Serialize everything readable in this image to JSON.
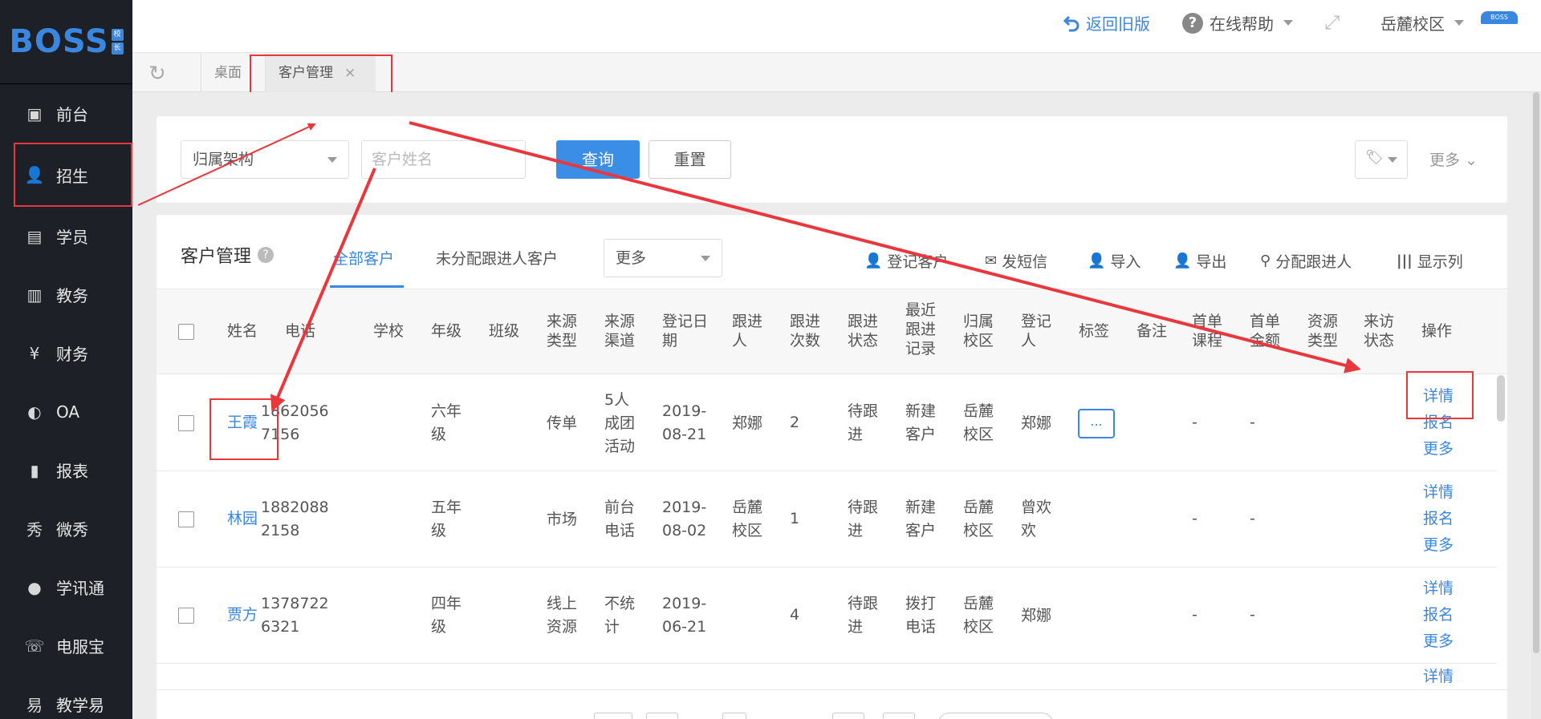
{
  "app": {
    "logo_main": "BOSS",
    "logo_badge": [
      "校",
      "长"
    ]
  },
  "sidebar": {
    "items": [
      {
        "label": "前台",
        "icon": "window-icon"
      },
      {
        "label": "招生",
        "icon": "user-add-icon"
      },
      {
        "label": "学员",
        "icon": "id-card-icon"
      },
      {
        "label": "教务",
        "icon": "book-icon"
      },
      {
        "label": "财务",
        "icon": "yen-icon"
      },
      {
        "label": "OA",
        "icon": "oa-icon"
      },
      {
        "label": "报表",
        "icon": "bar-chart-icon"
      },
      {
        "label": "微秀",
        "icon": "weixiu-icon"
      },
      {
        "label": "学讯通",
        "icon": "location-pin-icon"
      },
      {
        "label": "电服宝",
        "icon": "phone-icon"
      },
      {
        "label": "教学易",
        "icon": "teach-icon"
      }
    ]
  },
  "topbar": {
    "back_label": "返回旧版",
    "help_label": "在线帮助",
    "campus_label": "岳麓校区",
    "badge": "BOSS"
  },
  "tabs": {
    "items": [
      {
        "label": "桌面"
      },
      {
        "label": "客户管理",
        "close": "×"
      }
    ]
  },
  "filter": {
    "org_select": "归属架构",
    "name_placeholder": "客户姓名",
    "query_label": "查询",
    "reset_label": "重置",
    "more_label": "更多"
  },
  "main": {
    "title": "客户管理",
    "tab_all": "全部客户",
    "tab_unassigned": "未分配跟进人客户",
    "more_select": "更多",
    "actions": {
      "register": "登记客户",
      "sms": "发短信",
      "import": "导入",
      "export": "导出",
      "assign": "分配跟进人",
      "columns": "显示列"
    }
  },
  "table": {
    "headers": {
      "name": "姓名",
      "phone": "电话",
      "school": "学校",
      "grade": "年级",
      "class": "班级",
      "source_type": [
        "来源",
        "类型"
      ],
      "source_channel": [
        "来源",
        "渠道"
      ],
      "reg_date": [
        "登记日",
        "期"
      ],
      "follower": [
        "跟进",
        "人"
      ],
      "follow_count": [
        "跟进",
        "次数"
      ],
      "follow_status": [
        "跟进",
        "状态"
      ],
      "latest_record": [
        "最近",
        "跟进",
        "记录"
      ],
      "campus": [
        "归属",
        "校区"
      ],
      "registrar": [
        "登记",
        "人"
      ],
      "tags": "标签",
      "remark": "备注",
      "first_course": [
        "首单",
        "课程"
      ],
      "first_amount": [
        "首单",
        "金额"
      ],
      "resource_type": [
        "资源",
        "类型"
      ],
      "visit_status": [
        "来访",
        "状态"
      ],
      "ops": "操作"
    },
    "rows": [
      {
        "name": "王霞",
        "phone": [
          "1862056",
          "7156"
        ],
        "grade": [
          "六年",
          "级"
        ],
        "source_type": [
          "传单"
        ],
        "source_channel": [
          "5人",
          "成团",
          "活动"
        ],
        "reg_date": [
          "2019-",
          "08-21"
        ],
        "follower": [
          "郑娜"
        ],
        "follow_count": "2",
        "follow_status": [
          "待跟",
          "进"
        ],
        "latest_record": [
          "新建",
          "客户"
        ],
        "campus": [
          "岳麓",
          "校区"
        ],
        "registrar": [
          "郑娜"
        ],
        "tag_btn": "...",
        "first_course": "-",
        "first_amount": "-",
        "ops": [
          "详情",
          "报名",
          "更多"
        ]
      },
      {
        "name": "林园",
        "phone": [
          "1882088",
          "2158"
        ],
        "grade": [
          "五年",
          "级"
        ],
        "source_type": [
          "市场"
        ],
        "source_channel": [
          "前台",
          "电话"
        ],
        "reg_date": [
          "2019-",
          "08-02"
        ],
        "follower": [
          "岳麓",
          "校区"
        ],
        "follow_count": "1",
        "follow_status": [
          "待跟",
          "进"
        ],
        "latest_record": [
          "新建",
          "客户"
        ],
        "campus": [
          "岳麓",
          "校区"
        ],
        "registrar": [
          "曾欢",
          "欢"
        ],
        "first_course": "-",
        "first_amount": "-",
        "ops": [
          "详情",
          "报名",
          "更多"
        ]
      },
      {
        "name": "贾方",
        "phone": [
          "1378722",
          "6321"
        ],
        "grade": [
          "四年",
          "级"
        ],
        "source_type": [
          "线上",
          "资源"
        ],
        "source_channel": [
          "不统",
          "计"
        ],
        "reg_date": [
          "2019-",
          "06-21"
        ],
        "follower": [
          ""
        ],
        "follow_count": "4",
        "follow_status": [
          "待跟",
          "进"
        ],
        "latest_record": [
          "拨打",
          "电话"
        ],
        "campus": [
          "岳麓",
          "校区"
        ],
        "registrar": [
          "郑娜"
        ],
        "first_course": "-",
        "first_amount": "-",
        "ops": [
          "详情",
          "报名",
          "更多"
        ]
      }
    ],
    "partial_row_op": "详情"
  },
  "colors": {
    "accent": "#3a87e0",
    "sidebar_bg": "#1d2127",
    "highlight": "#e8383d"
  }
}
